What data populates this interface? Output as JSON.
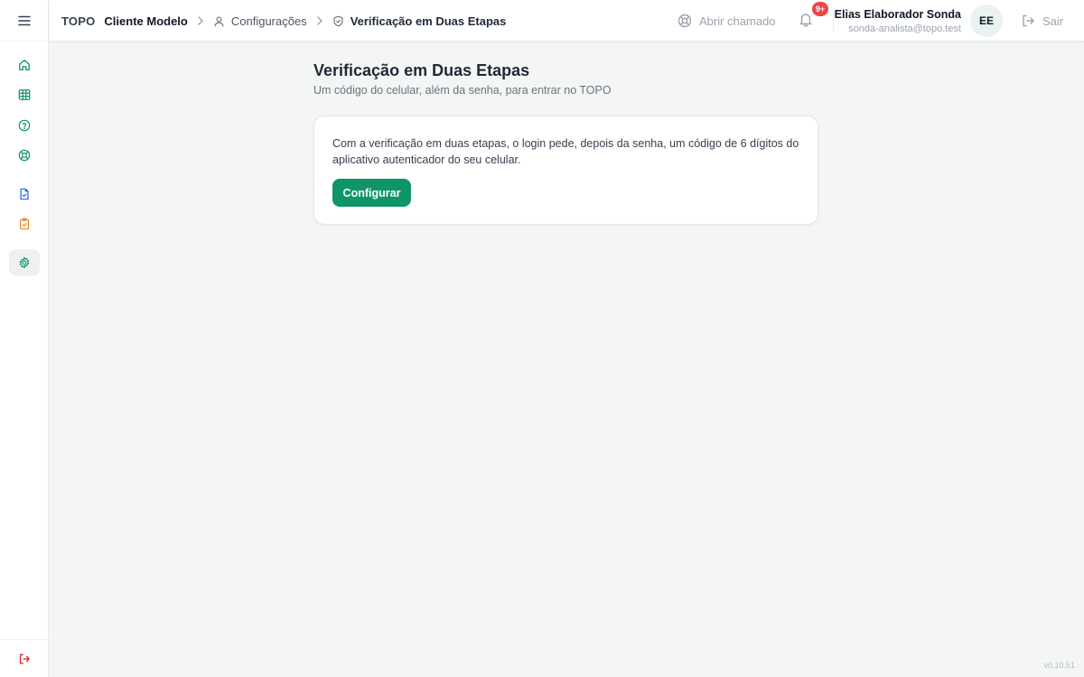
{
  "header": {
    "breadcrumb": {
      "brand": "TOPO",
      "client": "Cliente Modelo",
      "section": "Configurações",
      "current": "Verificação em Duas Etapas"
    },
    "ticket_label": "Abrir chamado",
    "notifications_badge": "9+",
    "user": {
      "name": "Elias Elaborador Sonda",
      "email": "sonda-analista@topo.test",
      "initials": "EE"
    },
    "logout_label": "Sair"
  },
  "sidebar": {
    "items": [
      {
        "icon": "home-icon",
        "color": "#0f9566"
      },
      {
        "icon": "table-icon",
        "color": "#0f9566"
      },
      {
        "icon": "help-circle-icon",
        "color": "#0f9566"
      },
      {
        "icon": "lifebuoy-icon",
        "color": "#0f9566"
      },
      {
        "icon": "document-icon",
        "color": "#2563eb"
      },
      {
        "icon": "clipboard-check-icon",
        "color": "#ea8a1e"
      },
      {
        "icon": "gear-icon",
        "color": "#0f9566",
        "active": true
      }
    ],
    "bottom_icon": "logout-icon",
    "bottom_color": "#dc2626"
  },
  "main": {
    "title": "Verificação em Duas Etapas",
    "subtitle": "Um código do celular, além da senha, para entrar no TOPO",
    "card": {
      "description": "Com a verificação em duas etapas, o login pede, depois da senha, um código de 6 dígitos do aplicativo autenticador do seu celular.",
      "button_label": "Configurar"
    }
  },
  "footer": {
    "version": "v0.10.51"
  },
  "colors": {
    "accent": "#0f9566",
    "badge": "#ef4444",
    "background": "#f3f6f4"
  }
}
